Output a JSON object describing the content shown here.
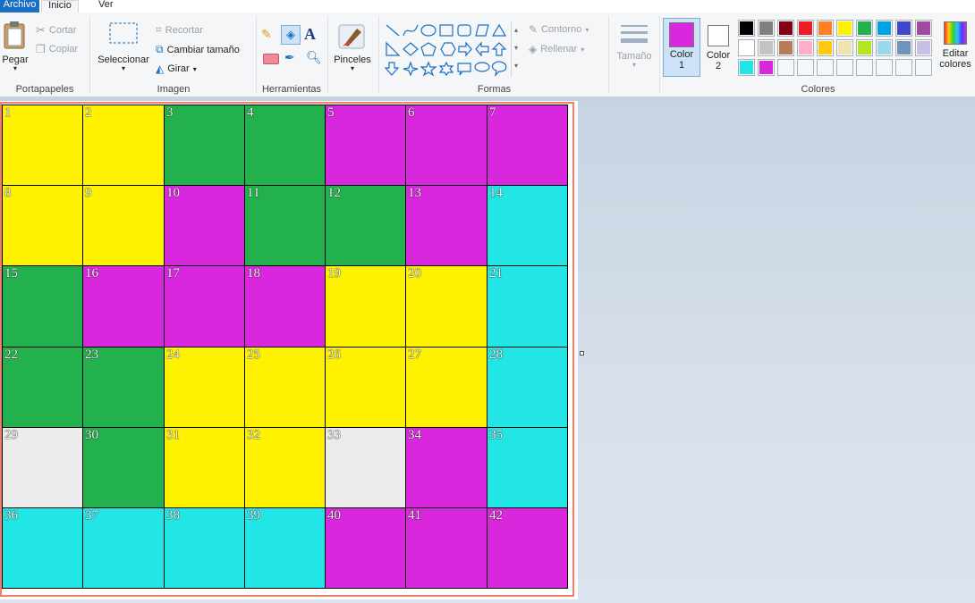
{
  "tabs": {
    "file": "Archivo",
    "home": "Inicio",
    "view": "Ver"
  },
  "clipboard": {
    "paste": "Pegar",
    "cut": "Cortar",
    "copy": "Copiar",
    "label": "Portapapeles"
  },
  "image": {
    "select": "Seleccionar",
    "crop": "Recortar",
    "resize": "Cambiar tamaño",
    "rotate": "Girar",
    "label": "Imagen"
  },
  "tools": {
    "label": "Herramientas"
  },
  "brushes": {
    "label": "Pinceles"
  },
  "shapes": {
    "outline": "Contorno",
    "fill": "Rellenar",
    "label": "Formas"
  },
  "size": {
    "label": "Tamaño"
  },
  "colors": {
    "color1": "Color 1",
    "color1_line1": "Color",
    "color1_line2": "1",
    "color2_line1": "Color",
    "color2_line2": "2",
    "edit_line1": "Editar",
    "edit_line2": "colores",
    "label": "Colores",
    "color1_value": "#d827dc",
    "color2_value": "#ffffff",
    "palette": [
      [
        "#000000",
        "#7f7f7f",
        "#880015",
        "#ed1c24",
        "#ff7f27",
        "#fff200",
        "#22b14c",
        "#00a2e8",
        "#3f48cc",
        "#a349a4"
      ],
      [
        "#ffffff",
        "#c3c3c3",
        "#b97a57",
        "#ffaec9",
        "#ffc90e",
        "#efe4b0",
        "#b5e61d",
        "#99d9ea",
        "#7092be",
        "#c8bfe7"
      ],
      [
        "#22e5e5",
        "#d827dc",
        "",
        "",
        "",
        "",
        "",
        "",
        "",
        ""
      ]
    ]
  },
  "grid": {
    "cols": 7,
    "rows": 6,
    "color_map": {
      "Y": "#fff200",
      "G": "#22b14c",
      "M": "#d827dc",
      "C": "#22e5e5",
      "W": "#ececec"
    },
    "cells": [
      {
        "n": "1",
        "c": "Y"
      },
      {
        "n": "2",
        "c": "Y"
      },
      {
        "n": "3",
        "c": "G"
      },
      {
        "n": "4",
        "c": "G"
      },
      {
        "n": "5",
        "c": "M"
      },
      {
        "n": "6",
        "c": "M"
      },
      {
        "n": "7",
        "c": "M"
      },
      {
        "n": "8",
        "c": "Y"
      },
      {
        "n": "9",
        "c": "Y"
      },
      {
        "n": "10",
        "c": "M"
      },
      {
        "n": "11",
        "c": "G"
      },
      {
        "n": "12",
        "c": "G"
      },
      {
        "n": "13",
        "c": "M"
      },
      {
        "n": "14",
        "c": "C"
      },
      {
        "n": "15",
        "c": "G"
      },
      {
        "n": "16",
        "c": "M"
      },
      {
        "n": "17",
        "c": "M"
      },
      {
        "n": "18",
        "c": "M"
      },
      {
        "n": "19",
        "c": "Y"
      },
      {
        "n": "20",
        "c": "Y"
      },
      {
        "n": "21",
        "c": "C"
      },
      {
        "n": "22",
        "c": "G"
      },
      {
        "n": "23",
        "c": "G"
      },
      {
        "n": "24",
        "c": "Y"
      },
      {
        "n": "25",
        "c": "Y"
      },
      {
        "n": "26",
        "c": "Y"
      },
      {
        "n": "27",
        "c": "Y"
      },
      {
        "n": "28",
        "c": "C"
      },
      {
        "n": "29",
        "c": "W"
      },
      {
        "n": "30",
        "c": "G"
      },
      {
        "n": "31",
        "c": "Y"
      },
      {
        "n": "32",
        "c": "Y"
      },
      {
        "n": "33",
        "c": "W"
      },
      {
        "n": "34",
        "c": "M"
      },
      {
        "n": "35",
        "c": "C"
      },
      {
        "n": "36",
        "c": "C"
      },
      {
        "n": "37",
        "c": "C"
      },
      {
        "n": "38",
        "c": "C"
      },
      {
        "n": "39",
        "c": "C"
      },
      {
        "n": "40",
        "c": "M"
      },
      {
        "n": "41",
        "c": "M"
      },
      {
        "n": "42",
        "c": "M"
      }
    ]
  }
}
